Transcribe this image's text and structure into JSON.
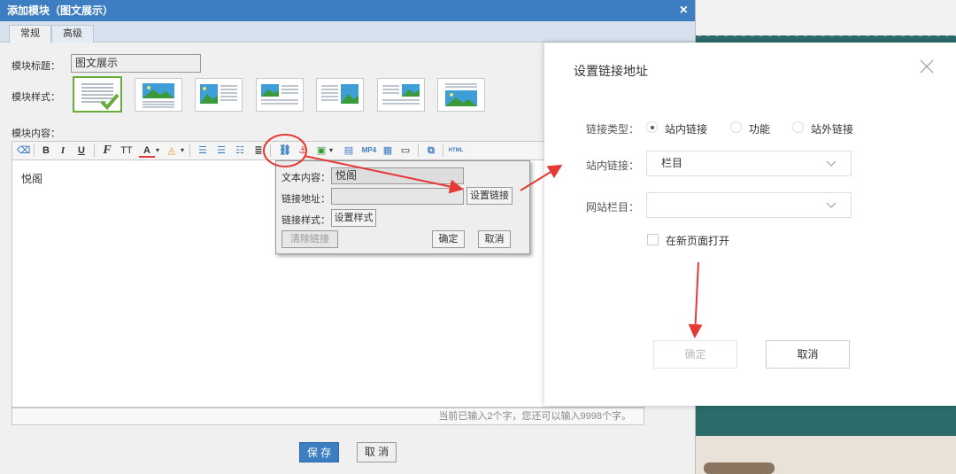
{
  "dialog": {
    "title": "添加模块（图文展示）",
    "close_glyph": "×",
    "tabs": [
      {
        "label": "常规",
        "active": true
      },
      {
        "label": "高级",
        "active": false
      }
    ],
    "module_title_label": "模块标题：",
    "module_title_value": "图文展示",
    "module_style_label": "模块样式：",
    "module_content_label": "模块内容：",
    "styles": [
      "text-only",
      "image-top-text-bottom",
      "image-left-text-right",
      "image-left-text-right-2",
      "text-left-image-right",
      "text-left-image-right-2",
      "text-top-image-bottom"
    ],
    "toolbar": {
      "bold": "B",
      "italic": "I",
      "underline": "U",
      "font_family": "F",
      "font_size": "TT",
      "font_color": "A",
      "mp4_label": "MP4",
      "html_label": "HTML"
    },
    "editor_text": "悦阁",
    "counter_text": "当前已输入2个字，您还可以输入9998个字。",
    "save_label": "保 存",
    "cancel_label": "取 消"
  },
  "link_popup": {
    "text_label": "文本内容：",
    "text_value": "悦阁",
    "url_label": "链接地址：",
    "url_value": "",
    "set_link_button": "设置链接",
    "style_label": "链接样式：",
    "set_style_button": "设置样式",
    "clear_link_button": "清除链接",
    "confirm_button": "确定",
    "cancel_button": "取消"
  },
  "link_dialog": {
    "title": "设置链接地址",
    "close_glyph": "×",
    "link_type_label": "链接类型：",
    "link_type_options": [
      {
        "label": "站内链接",
        "checked": true
      },
      {
        "label": "功能",
        "checked": false
      },
      {
        "label": "站外链接",
        "checked": false
      }
    ],
    "internal_link_label": "站内链接：",
    "internal_link_value": "栏目",
    "site_column_label": "网站栏目：",
    "site_column_value": "",
    "new_window_label": "在新页面打开",
    "ok_button": "确定",
    "cancel_button": "取消"
  },
  "colors": {
    "title_bar": "#3d7dc2",
    "selected_style_border": "#6aac3a",
    "annotation_red": "#e53935"
  }
}
